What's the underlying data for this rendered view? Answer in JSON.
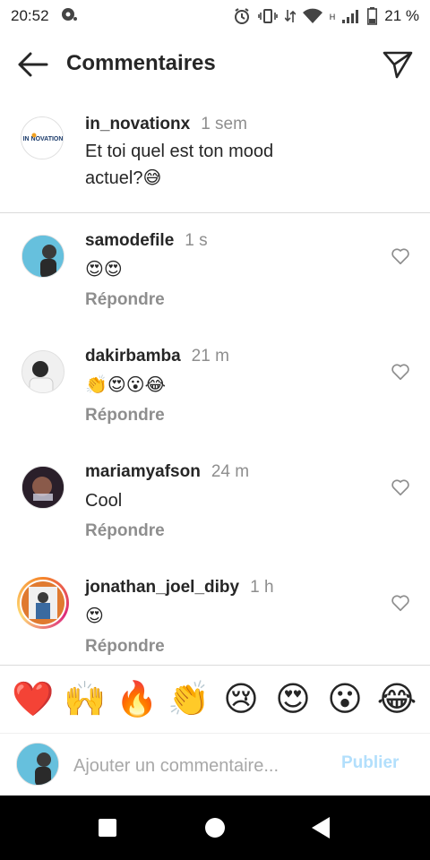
{
  "status_bar": {
    "time": "20:52",
    "network_type": "H",
    "battery": "21 %"
  },
  "header": {
    "title": "Commentaires"
  },
  "caption": {
    "username": "in_novationx",
    "time": "1 sem",
    "text": "Et toi quel est ton mood actuel?😅"
  },
  "comments": [
    {
      "username": "samodefile",
      "time": "1 s",
      "text": "😍😍",
      "reply_label": "Répondre"
    },
    {
      "username": "dakirbamba",
      "time": "21 m",
      "text": "👏😍😮😂",
      "reply_label": "Répondre"
    },
    {
      "username": "mariamyafson",
      "time": "24 m",
      "text": "Cool",
      "reply_label": "Répondre"
    },
    {
      "username": "jonathan_joel_diby",
      "time": "1 h",
      "text": "😍",
      "reply_label": "Répondre"
    }
  ],
  "emoji_bar": [
    "❤️",
    "🙌",
    "🔥",
    "👏",
    "😢",
    "😍",
    "😮",
    "😂"
  ],
  "input": {
    "placeholder": "Ajouter un commentaire...",
    "publish_label": "Publier"
  },
  "colors": {
    "text": "#262626",
    "secondary": "#8e8e8e",
    "publish_disabled": "#b2dffc",
    "divider": "#dbdbdb",
    "nav_bar": "#000000"
  }
}
